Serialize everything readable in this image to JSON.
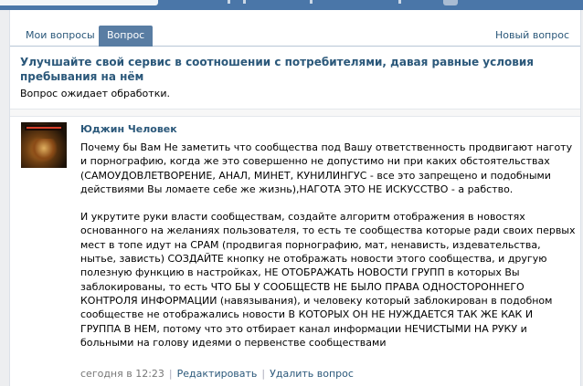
{
  "tabs": {
    "my_questions": "Мои вопросы",
    "question": "Вопрос",
    "new_question": "Новый вопрос"
  },
  "question": {
    "title": "Улучшайте свой сервис в соотношении с потребителями, давая равные условия пребывания на нём",
    "status": "Вопрос ожидает обработки."
  },
  "reply": {
    "avatar_logo": "BEZPROTAKE",
    "author": "Юджин Человек",
    "paragraph_1": "Почему бы Вам Не заметить что сообщества под Вашу ответственность продвигают наготу и порнографию, когда же это совершенно не допустимо ни при каких обстоятельствах (САМОУДОВЛЕТВОРЕНИЕ, АНАЛ, МИНЕТ, КУНИЛИНГУС - все это запрещено и подобными действиями Вы ломаете себе же жизнь),НАГОТА ЭТО НЕ ИСКУССТВО - а рабство.",
    "paragraph_2": "И укрутите руки власти сообществам, создайте алгоритм отображения в новостях основанного на желаниях пользователя, то есть те сообщества которые ради своих первых мест в топе идут на СРАМ (продвигая порнографию, мат, ненависть, издевательства, нытье, зависть) СОЗДАЙТЕ кнопку не отображать новости этого сообщества, и другую полезную функцию в настройках, НЕ ОТОБРАЖАТЬ НОВОСТИ ГРУПП в которых Вы заблокированы, то есть ЧТО БЫ У СООБЩЕСТВ НЕ БЫЛО ПРАВА ОДНОСТОРОННЕГО КОНТРОЛЯ ИНФОРМАЦИИ (навязывания), и человеку который заблокирован в подобном сообществе не отображались новости В КОТОРЫХ ОН НЕ НУЖДАЕТСЯ ТАК ЖЕ КАК И ГРУППА В НЕМ, потому что это отбирает канал информации НЕЧИСТЫМИ НА РУКУ и больными на голову идеями о первенстве сообществами",
    "timestamp": "сегодня в 12:23",
    "edit": "Редактировать",
    "delete": "Удалить вопрос",
    "separator": "|"
  }
}
